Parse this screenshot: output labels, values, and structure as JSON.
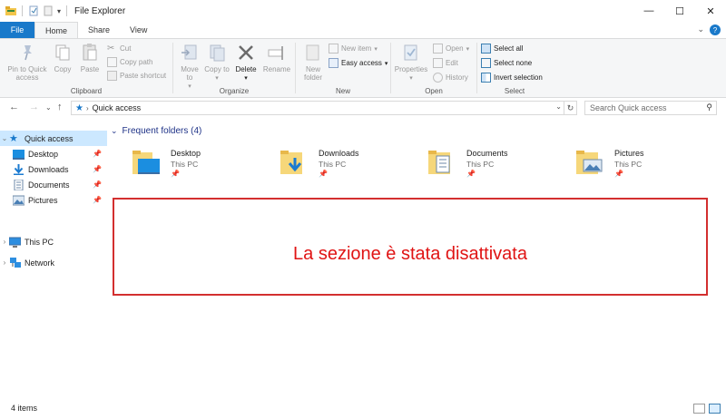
{
  "window": {
    "title": "File Explorer",
    "controls": {
      "minimize": "—",
      "maximize": "☐",
      "close": "✕"
    }
  },
  "ribbon_tabs": {
    "file": "File",
    "home": "Home",
    "share": "Share",
    "view": "View"
  },
  "ribbon": {
    "clipboard": {
      "label": "Clipboard",
      "pin": "Pin to Quick access",
      "copy": "Copy",
      "paste": "Paste",
      "cut": "Cut",
      "copy_path": "Copy path",
      "paste_shortcut": "Paste shortcut"
    },
    "organize": {
      "label": "Organize",
      "move_to": "Move to",
      "copy_to": "Copy to",
      "delete": "Delete",
      "rename": "Rename"
    },
    "new": {
      "label": "New",
      "new_folder": "New folder",
      "new_item": "New item",
      "easy_access": "Easy access"
    },
    "open": {
      "label": "Open",
      "properties": "Properties",
      "open": "Open",
      "edit": "Edit",
      "history": "History"
    },
    "select": {
      "label": "Select",
      "select_all": "Select all",
      "select_none": "Select none",
      "invert": "Invert selection"
    }
  },
  "address": {
    "crumb": "Quick access",
    "search_placeholder": "Search Quick access"
  },
  "nav": {
    "quick_access": "Quick access",
    "items": [
      {
        "label": "Desktop"
      },
      {
        "label": "Downloads"
      },
      {
        "label": "Documents"
      },
      {
        "label": "Pictures"
      }
    ],
    "this_pc": "This PC",
    "network": "Network"
  },
  "content": {
    "section_title": "Frequent folders (4)",
    "folders": [
      {
        "name": "Desktop",
        "location": "This PC"
      },
      {
        "name": "Downloads",
        "location": "This PC"
      },
      {
        "name": "Documents",
        "location": "This PC"
      },
      {
        "name": "Pictures",
        "location": "This PC"
      }
    ],
    "disabled_message": "La sezione è stata disattivata"
  },
  "status": {
    "item_count": "4 items"
  },
  "colors": {
    "accent": "#1979ca",
    "selection": "#cce8ff",
    "warning_red": "#e01414"
  }
}
